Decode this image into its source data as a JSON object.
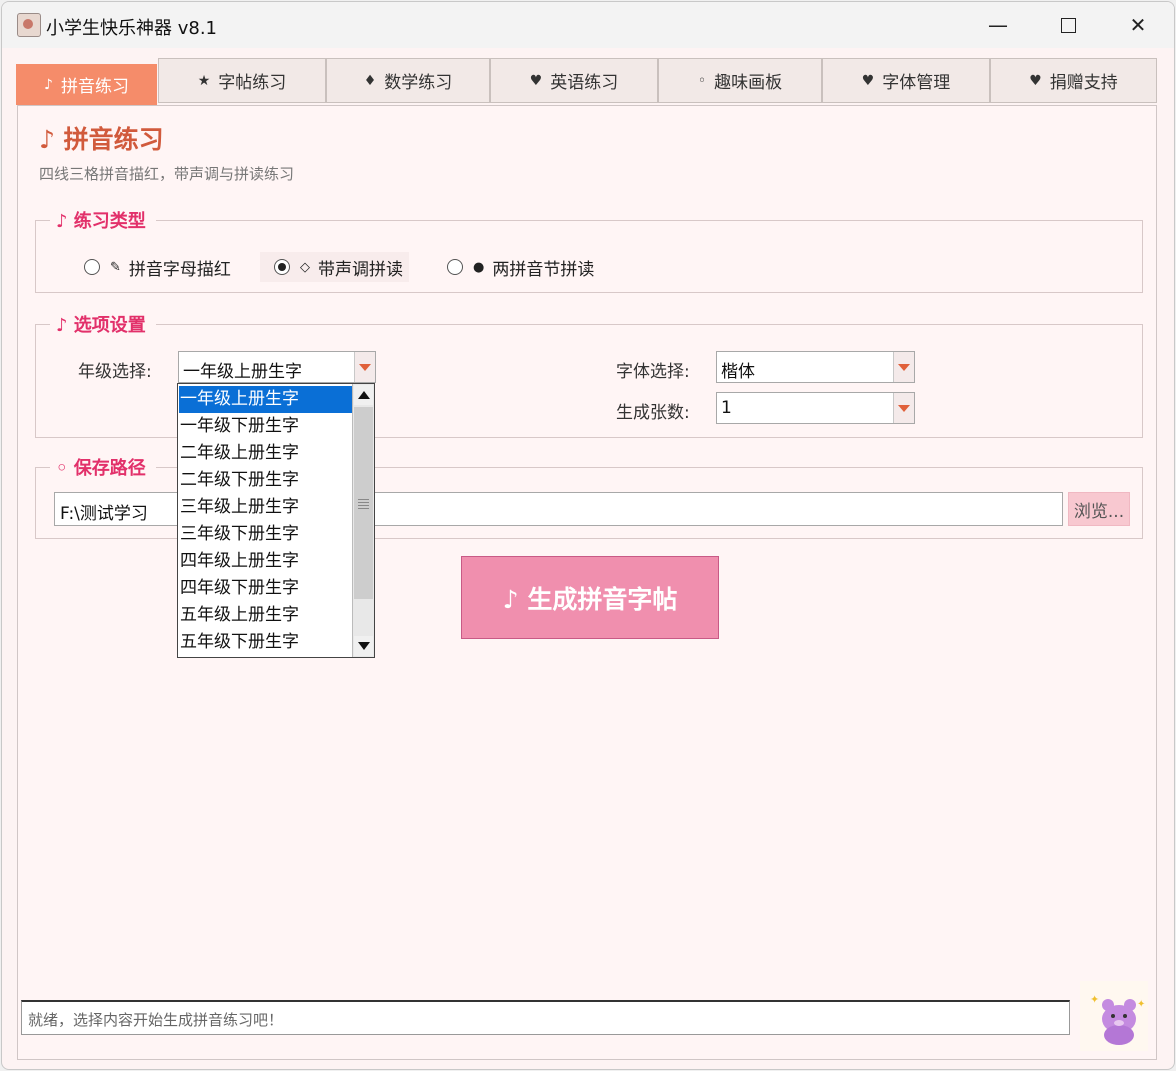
{
  "window": {
    "title": "小学生快乐神器 v8.1",
    "min_glyph": "—",
    "close_glyph": "✕"
  },
  "tabs": [
    {
      "icon": "♪",
      "label": "拼音练习",
      "active": true
    },
    {
      "icon": "★",
      "label": "字帖练习"
    },
    {
      "icon": "♦",
      "label": "数学练习"
    },
    {
      "icon": "♥",
      "label": "英语练习"
    },
    {
      "icon": "◦",
      "label": "趣味画板"
    },
    {
      "icon": "♥",
      "label": "字体管理"
    },
    {
      "icon": "♥",
      "label": "捐赠支持"
    }
  ],
  "page": {
    "title": "♪ 拼音练习",
    "subtitle": "四线三格拼音描红，带声调与拼读练习"
  },
  "practice_type": {
    "title": "♪ 练习类型",
    "options": [
      {
        "glyph": "✎",
        "label": "拼音字母描红",
        "selected": false
      },
      {
        "glyph": "◇",
        "label": "带声调拼读",
        "selected": true
      },
      {
        "glyph": "●",
        "label": "两拼音节拼读",
        "selected": false
      }
    ]
  },
  "options": {
    "title": "♪ 选项设置",
    "grade_label": "年级选择:",
    "grade_value": "一年级上册生字",
    "font_label": "字体选择:",
    "font_value": "楷体",
    "count_label": "生成张数:",
    "count_value": "1"
  },
  "grade_dropdown": {
    "items": [
      "一年级上册生字",
      "一年级下册生字",
      "二年级上册生字",
      "二年级下册生字",
      "三年级上册生字",
      "三年级下册生字",
      "四年级上册生字",
      "四年级下册生字",
      "五年级上册生字",
      "五年级下册生字"
    ],
    "highlighted_index": 0
  },
  "save_path": {
    "title": "◦ 保存路径",
    "value": "F:\\测试学习",
    "browse_label": "浏览..."
  },
  "generate_button": {
    "label": "♪ 生成拼音字帖"
  },
  "status": {
    "text": "就绪，选择内容开始生成拼音练习吧！"
  },
  "colors": {
    "accent": "#f58c6a",
    "section_title": "#e2306a",
    "page_title": "#d15a3c",
    "generate": "#f08fae",
    "highlight": "#0a6fd6"
  }
}
